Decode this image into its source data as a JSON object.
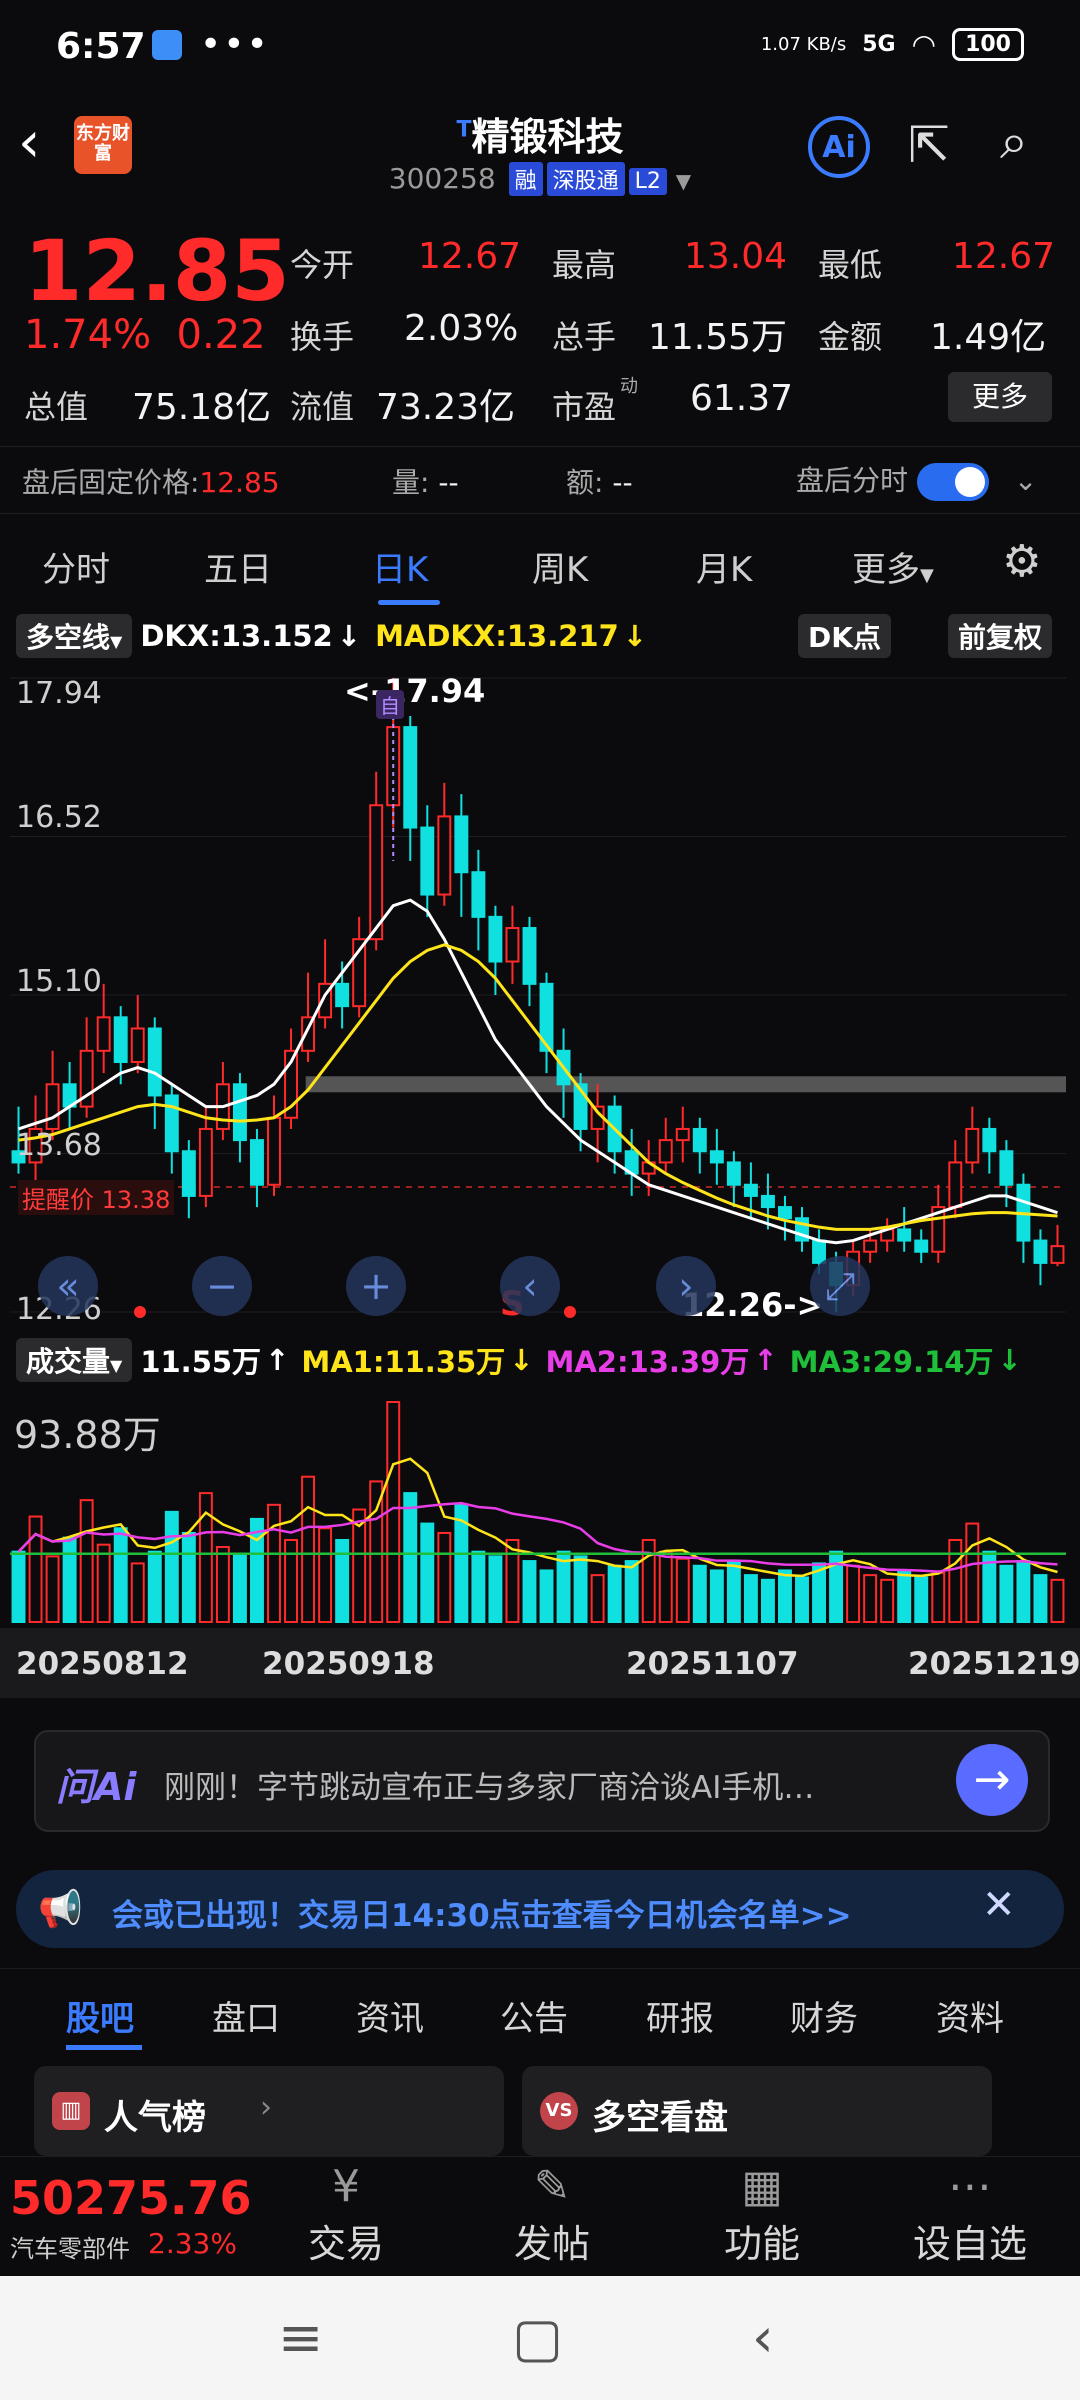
{
  "status": {
    "time": "6:57",
    "dots": "•••",
    "speed": "1.07 KB/s",
    "signal": "5G",
    "battery": "100"
  },
  "header": {
    "logo": "东方财富",
    "title": "精锻科技",
    "title_sup": "T",
    "code": "300258",
    "tags": [
      "融",
      "深股通",
      "L2"
    ],
    "ai_label": "Ai"
  },
  "quote": {
    "price": "12.85",
    "change_pct": "1.74%",
    "change": "0.22",
    "fields": [
      {
        "label": "今开",
        "value": "12.67",
        "color": "red"
      },
      {
        "label": "最高",
        "value": "13.04",
        "color": "red"
      },
      {
        "label": "最低",
        "value": "12.67",
        "color": "red"
      },
      {
        "label": "换手",
        "value": "2.03%",
        "color": "white"
      },
      {
        "label": "总手",
        "value": "11.55万",
        "color": "white"
      },
      {
        "label": "金额",
        "value": "1.49亿",
        "color": "white"
      },
      {
        "label": "总值",
        "value": "75.18亿",
        "color": "white"
      },
      {
        "label": "流值",
        "value": "73.23亿",
        "color": "white"
      },
      {
        "label": "市盈",
        "value": "61.37",
        "color": "white",
        "sup": "动"
      }
    ],
    "more": "更多"
  },
  "afterhours": {
    "fixed_label": "盘后固定价格:",
    "fixed_value": "12.85",
    "vol_label": "量:",
    "vol_value": "--",
    "amt_label": "额:",
    "amt_value": "--",
    "toggle_label": "盘后分时"
  },
  "period_tabs": [
    "分时",
    "五日",
    "日K",
    "周K",
    "月K",
    "更多"
  ],
  "indicator": {
    "name": "多空线",
    "dkx": "DKX:13.152",
    "madkx": "MADKX:13.217",
    "dk_btn": "DK点",
    "fq_btn": "前复权"
  },
  "kchart": {
    "y_labels": [
      "17.94",
      "16.52",
      "15.10",
      "13.68",
      "12.26"
    ],
    "high_note": "<-17.94",
    "low_note": "12.26->",
    "alert_label": "提醒价 13.38",
    "marker_b": "自",
    "marker_s": "S"
  },
  "volume": {
    "name": "成交量",
    "value": "11.55万",
    "ma1": "MA1:11.35万",
    "ma2": "MA2:13.39万",
    "ma3": "MA3:29.14万",
    "max_label": "93.88万",
    "dates": [
      "20250812",
      "20250918",
      "20251107",
      "20251219"
    ]
  },
  "ai_bar": {
    "brand": "问Ai",
    "text": "刚刚！字节跳动宣布正与多家厂商洽谈AI手机…"
  },
  "banner": {
    "text": "会或已出现！交易日14:30点击查看今日机会名单>>"
  },
  "bottom_tabs": [
    "股吧",
    "盘口",
    "资讯",
    "公告",
    "研报",
    "财务",
    "资料"
  ],
  "cards": [
    {
      "label": "人气榜"
    },
    {
      "label": "多空看盘"
    }
  ],
  "toolbar": {
    "index_value": "50275.76",
    "index_name": "汽车零部件",
    "index_pct": "2.33%",
    "items": [
      "交易",
      "发帖",
      "功能",
      "设自选"
    ]
  },
  "chart_data": {
    "type": "candlestick",
    "y_range": [
      12.26,
      17.94
    ],
    "volume_max": 93.88,
    "candles": [
      [
        13.7,
        13.6,
        14.1,
        13.5
      ],
      [
        13.6,
        13.9,
        14.2,
        13.4
      ],
      [
        13.9,
        14.3,
        14.6,
        13.8
      ],
      [
        14.3,
        14.1,
        14.5,
        13.9
      ],
      [
        14.1,
        14.6,
        14.9,
        14.0
      ],
      [
        14.6,
        14.9,
        15.2,
        14.4
      ],
      [
        14.9,
        14.5,
        15.0,
        14.3
      ],
      [
        14.5,
        14.8,
        15.1,
        14.4
      ],
      [
        14.8,
        14.2,
        14.9,
        13.9
      ],
      [
        14.2,
        13.7,
        14.3,
        13.5
      ],
      [
        13.7,
        13.3,
        13.8,
        13.1
      ],
      [
        13.3,
        13.9,
        14.1,
        13.2
      ],
      [
        13.9,
        14.3,
        14.5,
        13.8
      ],
      [
        14.3,
        13.8,
        14.4,
        13.6
      ],
      [
        13.8,
        13.4,
        13.9,
        13.2
      ],
      [
        13.4,
        14.0,
        14.2,
        13.3
      ],
      [
        14.0,
        14.6,
        14.8,
        13.9
      ],
      [
        14.6,
        14.9,
        15.3,
        14.5
      ],
      [
        14.9,
        15.2,
        15.6,
        14.8
      ],
      [
        15.2,
        15.0,
        15.4,
        14.8
      ],
      [
        15.0,
        15.6,
        15.8,
        14.9
      ],
      [
        15.6,
        16.8,
        17.1,
        15.5
      ],
      [
        16.8,
        17.5,
        17.94,
        16.6
      ],
      [
        17.5,
        16.6,
        17.6,
        16.3
      ],
      [
        16.6,
        16.0,
        16.8,
        15.8
      ],
      [
        16.0,
        16.7,
        17.0,
        15.9
      ],
      [
        16.7,
        16.2,
        16.9,
        15.8
      ],
      [
        16.2,
        15.8,
        16.4,
        15.5
      ],
      [
        15.8,
        15.4,
        15.9,
        15.1
      ],
      [
        15.4,
        15.7,
        15.9,
        15.2
      ],
      [
        15.7,
        15.2,
        15.8,
        15.0
      ],
      [
        15.2,
        14.6,
        15.3,
        14.4
      ],
      [
        14.6,
        14.3,
        14.8,
        14.0
      ],
      [
        14.3,
        13.9,
        14.4,
        13.7
      ],
      [
        13.9,
        14.1,
        14.3,
        13.6
      ],
      [
        14.1,
        13.7,
        14.2,
        13.5
      ],
      [
        13.7,
        13.5,
        13.9,
        13.3
      ],
      [
        13.5,
        13.6,
        13.8,
        13.3
      ],
      [
        13.6,
        13.8,
        14.0,
        13.5
      ],
      [
        13.8,
        13.9,
        14.1,
        13.6
      ],
      [
        13.9,
        13.7,
        14.0,
        13.5
      ],
      [
        13.7,
        13.6,
        13.9,
        13.4
      ],
      [
        13.6,
        13.4,
        13.7,
        13.2
      ],
      [
        13.4,
        13.3,
        13.6,
        13.1
      ],
      [
        13.3,
        13.2,
        13.5,
        13.0
      ],
      [
        13.2,
        13.1,
        13.3,
        12.9
      ],
      [
        13.1,
        12.9,
        13.2,
        12.8
      ],
      [
        12.9,
        12.7,
        13.0,
        12.6
      ],
      [
        12.7,
        12.5,
        12.8,
        12.26
      ],
      [
        12.5,
        12.8,
        12.9,
        12.4
      ],
      [
        12.8,
        12.9,
        13.0,
        12.7
      ],
      [
        12.9,
        13.0,
        13.1,
        12.8
      ],
      [
        13.0,
        12.9,
        13.2,
        12.8
      ],
      [
        12.9,
        12.8,
        13.0,
        12.7
      ],
      [
        12.8,
        13.2,
        13.4,
        12.7
      ],
      [
        13.2,
        13.6,
        13.8,
        13.1
      ],
      [
        13.6,
        13.9,
        14.1,
        13.5
      ],
      [
        13.9,
        13.7,
        14.0,
        13.5
      ],
      [
        13.7,
        13.4,
        13.8,
        13.2
      ],
      [
        13.4,
        12.9,
        13.5,
        12.7
      ],
      [
        12.9,
        12.7,
        13.0,
        12.5
      ],
      [
        12.7,
        12.85,
        13.04,
        12.67
      ]
    ],
    "volumes": [
      30,
      45,
      28,
      36,
      52,
      33,
      40,
      25,
      30,
      47,
      38,
      55,
      32,
      29,
      44,
      50,
      35,
      62,
      40,
      35,
      48,
      60,
      93.88,
      55,
      42,
      38,
      50,
      30,
      28,
      35,
      26,
      22,
      30,
      28,
      20,
      24,
      26,
      35,
      30,
      27,
      24,
      22,
      26,
      20,
      18,
      22,
      19,
      25,
      30,
      24,
      20,
      18,
      22,
      19,
      21,
      35,
      42,
      30,
      24,
      26,
      20,
      18
    ],
    "ma_white": [
      13.9,
      13.95,
      14.0,
      14.1,
      14.2,
      14.3,
      14.4,
      14.45,
      14.4,
      14.3,
      14.2,
      14.1,
      14.1,
      14.15,
      14.2,
      14.3,
      14.5,
      14.8,
      15.1,
      15.3,
      15.5,
      15.7,
      15.9,
      15.95,
      15.85,
      15.6,
      15.3,
      15.0,
      14.7,
      14.5,
      14.3,
      14.1,
      13.95,
      13.8,
      13.7,
      13.6,
      13.5,
      13.4,
      13.35,
      13.3,
      13.25,
      13.2,
      13.15,
      13.1,
      13.05,
      13.0,
      12.95,
      12.9,
      12.88,
      12.9,
      12.95,
      13.0,
      13.05,
      13.1,
      13.15,
      13.2,
      13.25,
      13.3,
      13.3,
      13.25,
      13.2,
      13.15
    ],
    "ma_yellow": [
      13.8,
      13.82,
      13.85,
      13.9,
      13.95,
      14.0,
      14.05,
      14.1,
      14.12,
      14.1,
      14.05,
      14.0,
      13.98,
      13.97,
      13.98,
      14.0,
      14.1,
      14.25,
      14.45,
      14.65,
      14.85,
      15.05,
      15.25,
      15.4,
      15.5,
      15.55,
      15.5,
      15.4,
      15.25,
      15.05,
      14.85,
      14.65,
      14.45,
      14.25,
      14.05,
      13.9,
      13.75,
      13.6,
      13.5,
      13.42,
      13.35,
      13.28,
      13.22,
      13.17,
      13.12,
      13.08,
      13.05,
      13.02,
      13.0,
      13.0,
      13.0,
      13.02,
      13.05,
      13.08,
      13.1,
      13.12,
      13.14,
      13.15,
      13.15,
      13.14,
      13.13,
      13.12
    ]
  }
}
